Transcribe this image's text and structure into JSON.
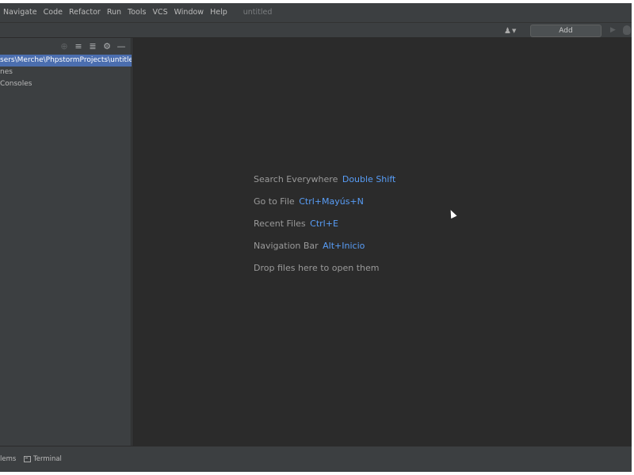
{
  "menu": {
    "items": [
      {
        "label": "Navigate"
      },
      {
        "label": "Code"
      },
      {
        "label": "Refactor"
      },
      {
        "label": "Run"
      },
      {
        "label": "Tools"
      },
      {
        "label": "VCS"
      },
      {
        "label": "Window"
      },
      {
        "label": "Help"
      }
    ],
    "project_title": "untitled"
  },
  "toolbar": {
    "user_icon": "user-icon",
    "add_configuration_label": "Add Configuration...",
    "run_icon": "play-icon",
    "debug_icon": "bug-icon"
  },
  "project_panel": {
    "header_icons": [
      "target-icon",
      "expand-all-icon",
      "collapse-all-icon",
      "gear-icon",
      "minimize-icon"
    ],
    "tree": [
      {
        "label": "sers\\Merche\\PhpstormProjects\\untitled",
        "selected": true
      },
      {
        "label": "nes",
        "selected": false
      },
      {
        "label": " Consoles",
        "selected": false
      }
    ]
  },
  "editor": {
    "hints": [
      {
        "text": "Search Everywhere",
        "shortcut": "Double Shift"
      },
      {
        "text": "Go to File",
        "shortcut": "Ctrl+Mayús+N"
      },
      {
        "text": "Recent Files",
        "shortcut": "Ctrl+E"
      },
      {
        "text": "Navigation Bar",
        "shortcut": "Alt+Inicio"
      },
      {
        "text": "Drop files here to open them",
        "shortcut": ""
      }
    ]
  },
  "bottom_strip": {
    "problems_label": "lems",
    "terminal_label": "Terminal"
  },
  "colors": {
    "background": "#3c3f41",
    "editor_background": "#2b2b2b",
    "selection": "#4b6eaf",
    "shortcut": "#589df6",
    "text": "#bbbbbb"
  }
}
